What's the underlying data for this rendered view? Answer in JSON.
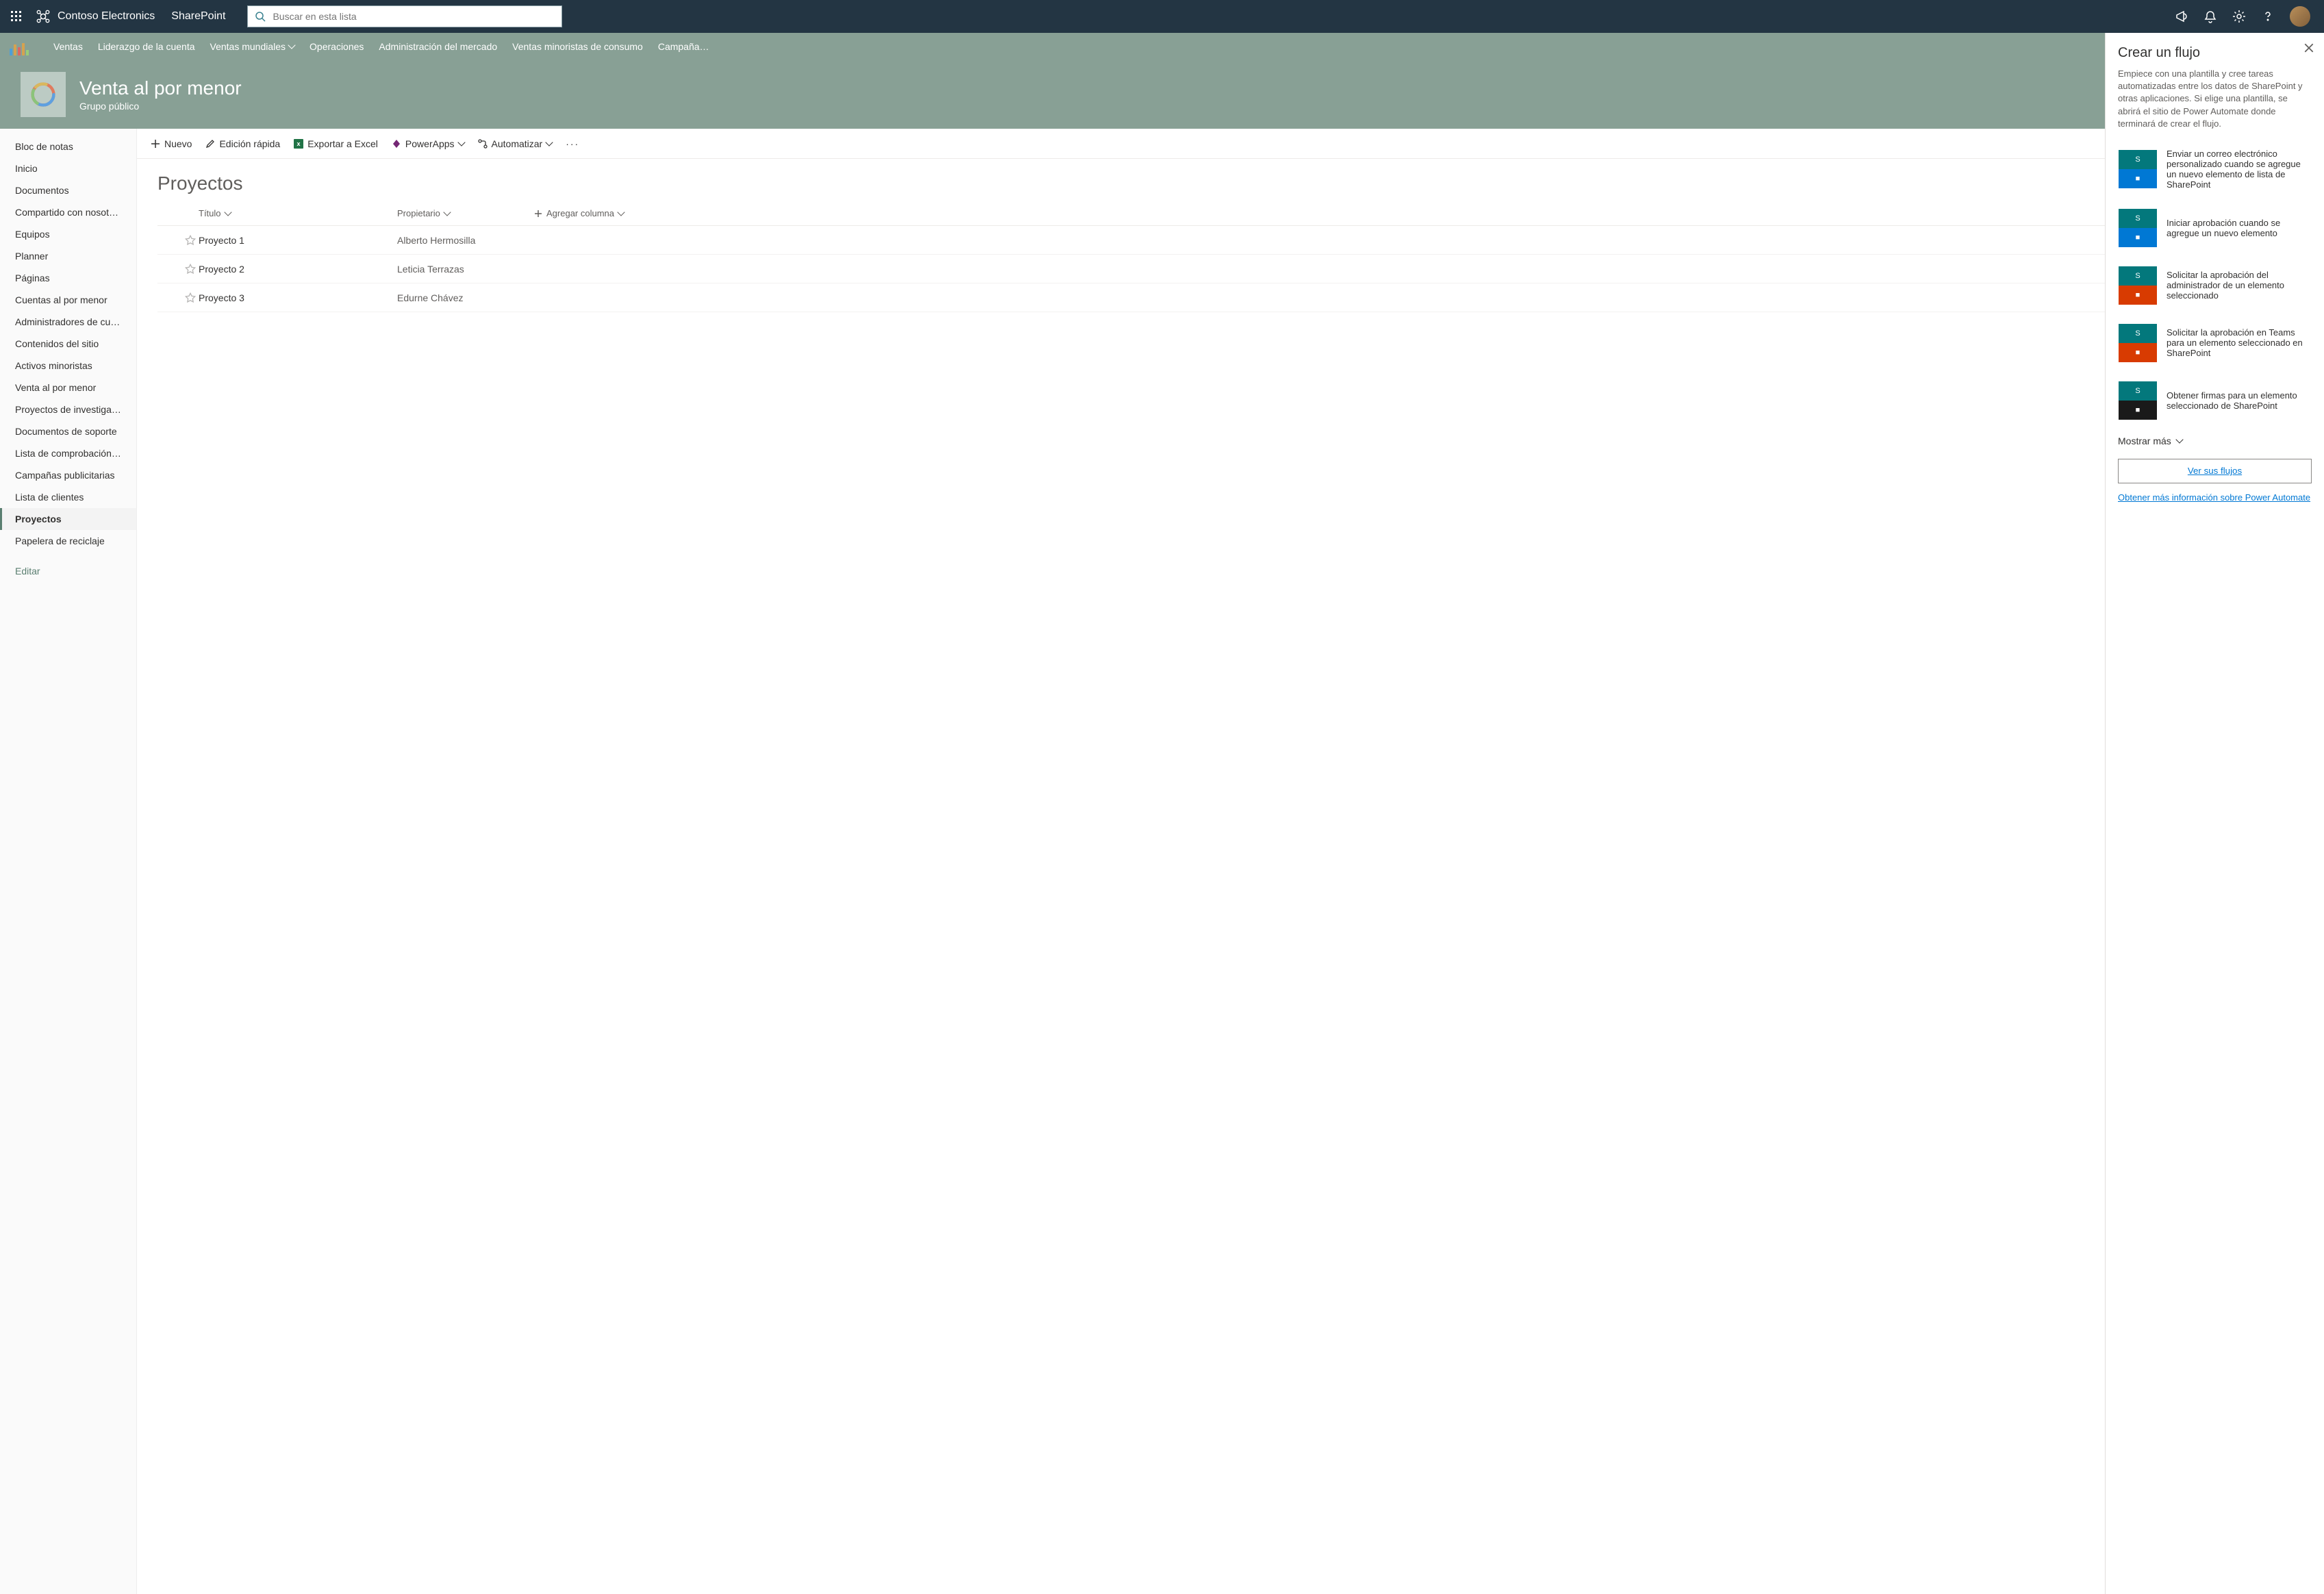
{
  "suite": {
    "brand": "Contoso Electronics",
    "app": "SharePoint",
    "search_placeholder": "Buscar en esta lista"
  },
  "hub": {
    "items": [
      "Ventas",
      "Liderazgo de la cuenta",
      "Ventas mundiales",
      "Operaciones",
      "Administración del mercado",
      "Ventas minoristas de consumo",
      "Campaña…"
    ]
  },
  "site": {
    "title": "Venta al por menor",
    "subtitle": "Grupo público"
  },
  "leftnav": {
    "items": [
      "Bloc de notas",
      "Inicio",
      "Documentos",
      "Compartido con nosotros",
      "Equipos",
      "Planner",
      "Páginas",
      "Cuentas al por menor",
      "Administradores de cuentas",
      "Contenidos del sitio",
      "Activos minoristas",
      "Venta al por menor",
      "Proyectos de investigación",
      "Documentos de soporte",
      "Lista de comprobación d…",
      "Campañas publicitarias",
      "Lista de clientes",
      "Proyectos",
      "Papelera de reciclaje"
    ],
    "edit": "Editar",
    "selected_index": 17
  },
  "cmdbar": {
    "new": "Nuevo",
    "quickedit": "Edición rápida",
    "export": "Exportar a Excel",
    "powerapps": "PowerApps",
    "automate": "Automatizar"
  },
  "list": {
    "title": "Proyectos",
    "columns": {
      "title": "Título",
      "owner": "Propietario",
      "add": "Agregar columna"
    },
    "rows": [
      {
        "title": "Proyecto 1",
        "owner": "Alberto Hermosilla"
      },
      {
        "title": "Proyecto 2",
        "owner": "Leticia Terrazas"
      },
      {
        "title": "Proyecto 3",
        "owner": "Edurne Chávez"
      }
    ]
  },
  "panel": {
    "title": "Crear un flujo",
    "desc": "Empiece con una plantilla y cree tareas automatizadas entre los datos de SharePoint y otras aplicaciones. Si elige una plantilla, se abrirá el sitio de Power Automate donde terminará de crear el flujo.",
    "templates": [
      "Enviar un correo electrónico personalizado cuando se agregue un nuevo elemento de lista de SharePoint",
      "Iniciar aprobación cuando se agregue un nuevo elemento",
      "Solicitar la aprobación del administrador de un elemento seleccionado",
      "Solicitar la aprobación en Teams para un elemento seleccionado en SharePoint",
      "Obtener firmas para un elemento seleccionado de SharePoint"
    ],
    "show_more": "Mostrar más",
    "see_flows": "Ver sus flujos",
    "learn_more": "Obtener más información sobre Power Automate"
  }
}
